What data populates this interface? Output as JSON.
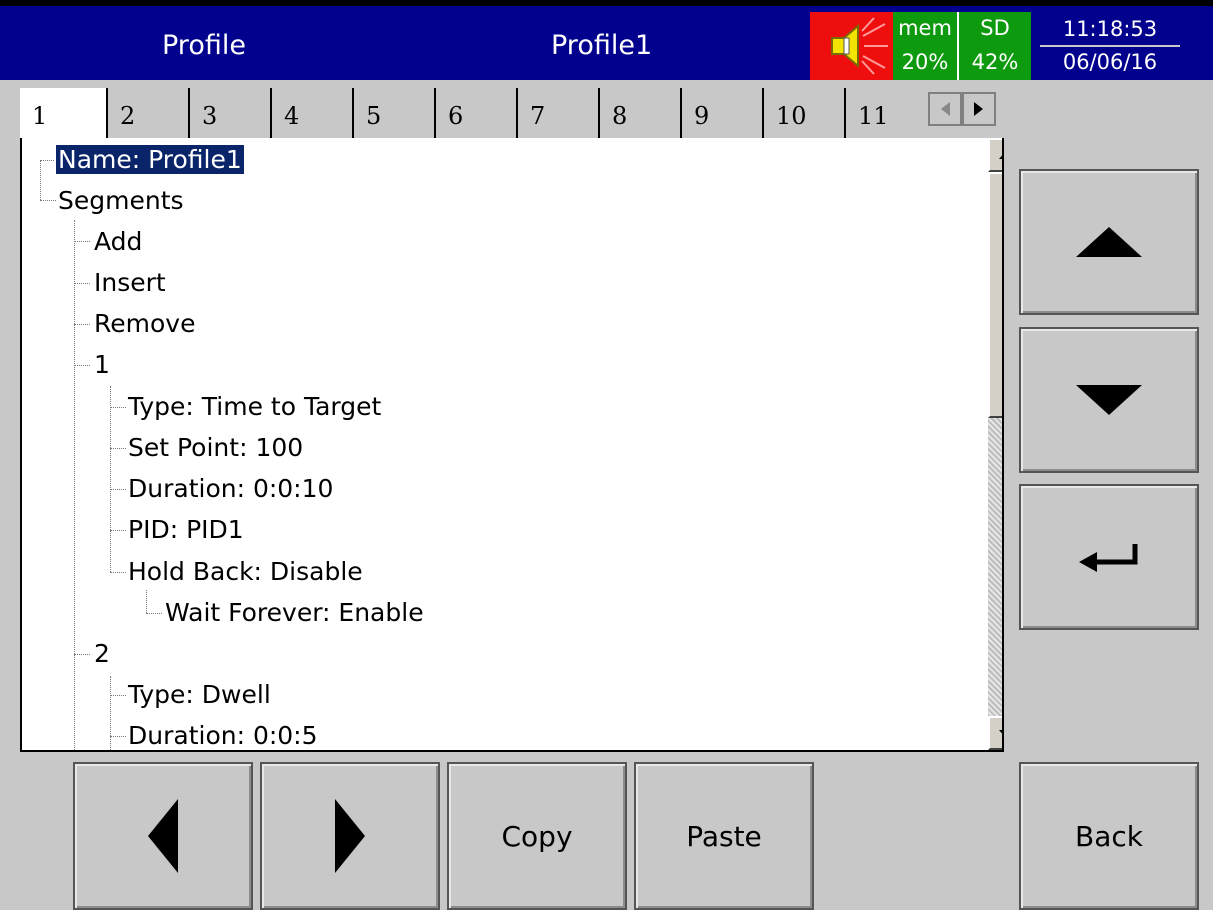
{
  "header": {
    "title": "Profile",
    "profile_name": "Profile1",
    "mem_label": "mem",
    "mem_value": "20%",
    "sd_label": "SD",
    "sd_value": "42%",
    "time": "11:18:53",
    "date": "06/06/16"
  },
  "tabs": [
    "1",
    "2",
    "3",
    "4",
    "5",
    "6",
    "7",
    "8",
    "9",
    "10",
    "11"
  ],
  "active_tab": "1",
  "tree": {
    "name": "Name: Profile1",
    "segments": "Segments",
    "add": "Add",
    "insert": "Insert",
    "remove": "Remove",
    "seg1": {
      "label": "1",
      "type": "Type: Time to Target",
      "setpoint": "Set Point: 100",
      "duration": "Duration: 0:0:10",
      "pid": "PID: PID1",
      "holdback": "Hold Back: Disable",
      "wait": "Wait Forever: Enable"
    },
    "seg2": {
      "label": "2",
      "type": "Type: Dwell",
      "duration": "Duration: 0:0:5"
    }
  },
  "buttons": {
    "copy": "Copy",
    "paste": "Paste",
    "back": "Back"
  },
  "icons": {
    "up": "up-arrow-icon",
    "down": "down-arrow-icon",
    "enter": "enter-icon",
    "left": "left-arrow-icon",
    "right": "right-arrow-icon",
    "speaker": "speaker-icon"
  },
  "colors": {
    "header_bg": "#01018e",
    "alarm_red": "#ee0e0e",
    "status_green": "#0e9a0e",
    "selection": "#0a246a"
  }
}
